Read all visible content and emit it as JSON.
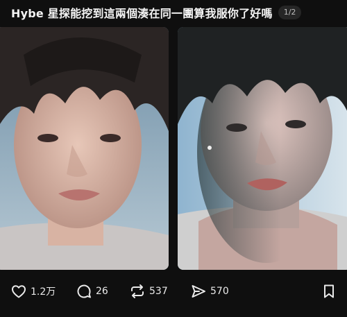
{
  "post": {
    "title": "Hybe 星探能挖到這兩個湊在同一團算我服你了好嗎",
    "page_indicator": "1/2"
  },
  "media": {
    "images": [
      {
        "icon": "photo-portrait-wet-hair"
      },
      {
        "icon": "photo-portrait-tank-top"
      }
    ]
  },
  "actions": {
    "like_count": "1.2万",
    "comment_count": "26",
    "repost_count": "537",
    "share_count": "570"
  },
  "colors": {
    "background": "#0f0f0f",
    "text": "#f2f2f2",
    "indicator_bg": "#262626"
  }
}
